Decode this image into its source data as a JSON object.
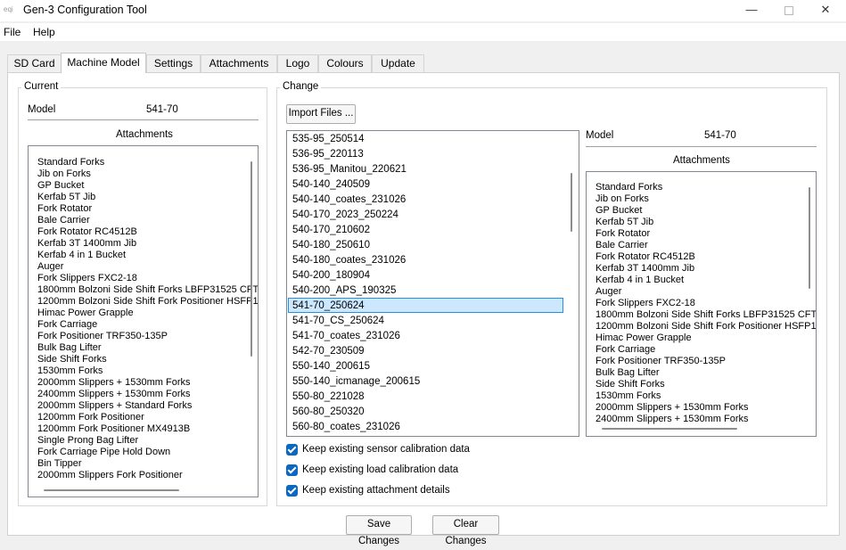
{
  "window": {
    "title": "Gen-3 Configuration Tool",
    "icon_text": "eqi",
    "min_glyph": "—",
    "close_glyph": "✕"
  },
  "menu": [
    "File",
    "Help"
  ],
  "tabs": [
    "SD Card",
    "Machine Model",
    "Settings",
    "Attachments",
    "Logo",
    "Colours",
    "Update"
  ],
  "current": {
    "group_label": "Current",
    "model_label": "Model",
    "model_value": "541-70",
    "attachments_label": "Attachments",
    "attachments": [
      "Standard Forks",
      "Jib on Forks",
      "GP Bucket",
      "Kerfab 5T Jib",
      "Fork Rotator",
      "Bale Carrier",
      "Fork Rotator RC4512B",
      "Kerfab 3T 1400mm Jib",
      "Kerfab 4 in 1 Bucket",
      "Auger",
      "Fork Slippers FXC2-18",
      "1800mm Bolzoni Side Shift Forks LBFP31525 CFT",
      "1200mm Bolzoni Side Shift Fork Positioner HSFP1",
      "Himac Power Grapple",
      "Fork Carriage",
      "Fork Positioner TRF350-135P",
      "Bulk Bag Lifter",
      "Side Shift Forks",
      "1530mm Forks",
      "2000mm Slippers + 1530mm Forks",
      "2400mm Slippers + 1530mm Forks",
      "2000mm Slippers + Standard Forks",
      "1200mm Fork Positioner",
      "1200mm Fork Positioner MX4913B",
      "Single Prong Bag Lifter",
      "Fork Carriage Pipe Hold Down",
      "Bin Tipper",
      "2000mm Slippers Fork Positioner"
    ]
  },
  "change": {
    "group_label": "Change",
    "import_button": "Import Files ...",
    "models": [
      "535-95_250514",
      "536-95_220113",
      "536-95_Manitou_220621",
      "540-140_240509",
      "540-140_coates_231026",
      "540-170_2023_250224",
      "540-170_210602",
      "540-180_250610",
      "540-180_coates_231026",
      "540-200_180904",
      "540-200_APS_190325",
      "541-70_250624",
      "541-70_CS_250624",
      "541-70_coates_231026",
      "542-70_230509",
      "550-140_200615",
      "550-140_icmanage_200615",
      "550-80_221028",
      "560-80_250320",
      "560-80_coates_231026"
    ],
    "selected_model": "541-70_250624",
    "model_label": "Model",
    "model_value": "541-70",
    "attachments_label": "Attachments",
    "attachments": [
      "Standard Forks",
      "Jib on Forks",
      "GP Bucket",
      "Kerfab 5T Jib",
      "Fork Rotator",
      "Bale Carrier",
      "Fork Rotator RC4512B",
      "Kerfab 3T 1400mm Jib",
      "Kerfab 4 in 1 Bucket",
      "Auger",
      "Fork Slippers FXC2-18",
      "1800mm Bolzoni Side Shift Forks LBFP31525 CFT",
      "1200mm Bolzoni Side Shift Fork Positioner HSFP1",
      "Himac Power Grapple",
      "Fork Carriage",
      "Fork Positioner TRF350-135P",
      "Bulk Bag Lifter",
      "Side Shift Forks",
      "1530mm Forks",
      "2000mm Slippers + 1530mm Forks",
      "2400mm Slippers + 1530mm Forks"
    ],
    "options": [
      {
        "label": "Keep existing sensor calibration data",
        "checked": true
      },
      {
        "label": "Keep existing load calibration data",
        "checked": true
      },
      {
        "label": "Keep existing attachment details",
        "checked": true
      }
    ]
  },
  "footer": {
    "save_label": "Save Changes",
    "clear_label": "Clear Changes"
  },
  "colors": {
    "selection_fill": "#cce8ff",
    "selection_border": "#2b8fe0",
    "checkbox": "#0b67c2"
  }
}
